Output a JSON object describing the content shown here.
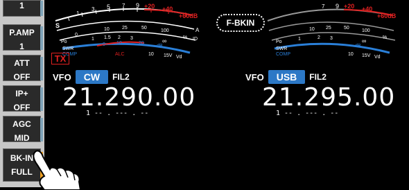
{
  "sidebar": {
    "items": [
      {
        "line1": "",
        "line2": "1"
      },
      {
        "line1": "P.AMP",
        "line2": "1"
      },
      {
        "line1": "ATT",
        "line2": "OFF"
      },
      {
        "line1": "IP+",
        "line2": "OFF"
      },
      {
        "line1": "AGC",
        "line2": "MID"
      },
      {
        "line1": "BK-IN",
        "line2": "FULL"
      }
    ]
  },
  "meter": {
    "top_scale": [
      "1",
      "3",
      "5",
      "7",
      "9",
      "+20",
      "+40",
      "+60dB"
    ],
    "s_label": "S",
    "po_scale": [
      "0",
      "10",
      "25",
      "50",
      "100"
    ],
    "po_unit": "%",
    "po_label": "Po",
    "swr_scale": [
      "1",
      "1.5",
      "2",
      "3",
      "∞"
    ],
    "swr_label": "SWR",
    "comp_scale": [
      "0",
      "10",
      "20"
    ],
    "comp_unit": "dB",
    "comp_label": "COMP",
    "alc_label": "ALC",
    "id_scale": [
      "10",
      "15V"
    ],
    "vd_label": "Vd",
    "id_label": "ID",
    "a_label": "A"
  },
  "left_vfo": {
    "tx_badge": "TX",
    "vfo_label": "VFO",
    "mode": "CW",
    "filter": "FIL2",
    "frequency": "21.290.00",
    "sub": "1  -- . --- . --"
  },
  "right_vfo": {
    "indicator": "F-BKIN",
    "vfo_label": "VFO",
    "mode": "USB",
    "filter": "FIL2",
    "frequency": "21.295.00",
    "sub": "1  -- . --- . --"
  },
  "colors": {
    "mode_blue": "#2c78c6",
    "tx_red": "#e02020",
    "meter_red": "#e02020",
    "meter_blue": "#2a7fd8",
    "sidebar_bg": "#c7c7c7"
  }
}
